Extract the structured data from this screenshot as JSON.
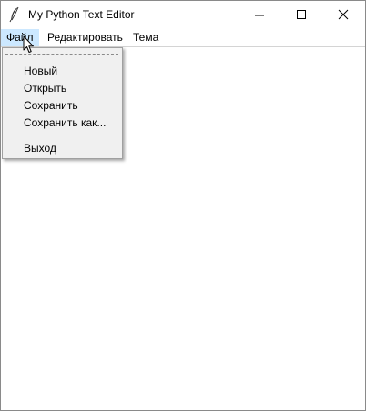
{
  "window": {
    "title": "My Python Text Editor",
    "app_icon": "feather-icon",
    "controls": {
      "minimize": "minimize-icon",
      "maximize": "maximize-icon",
      "close": "close-icon"
    }
  },
  "menubar": {
    "items": [
      {
        "label": "Файл",
        "active": true
      },
      {
        "label": "Редактировать",
        "active": false
      },
      {
        "label": "Тема",
        "active": false
      }
    ]
  },
  "file_menu": {
    "items": [
      {
        "label": "Новый"
      },
      {
        "label": "Открыть"
      },
      {
        "label": "Сохранить"
      },
      {
        "label": "Сохранить как..."
      },
      {
        "label": "Выход"
      }
    ]
  },
  "colors": {
    "menu_active_bg": "#cce8ff",
    "dropdown_bg": "#f0f0f0",
    "editor_bg": "#ffffff"
  },
  "editor": {
    "content": ""
  }
}
